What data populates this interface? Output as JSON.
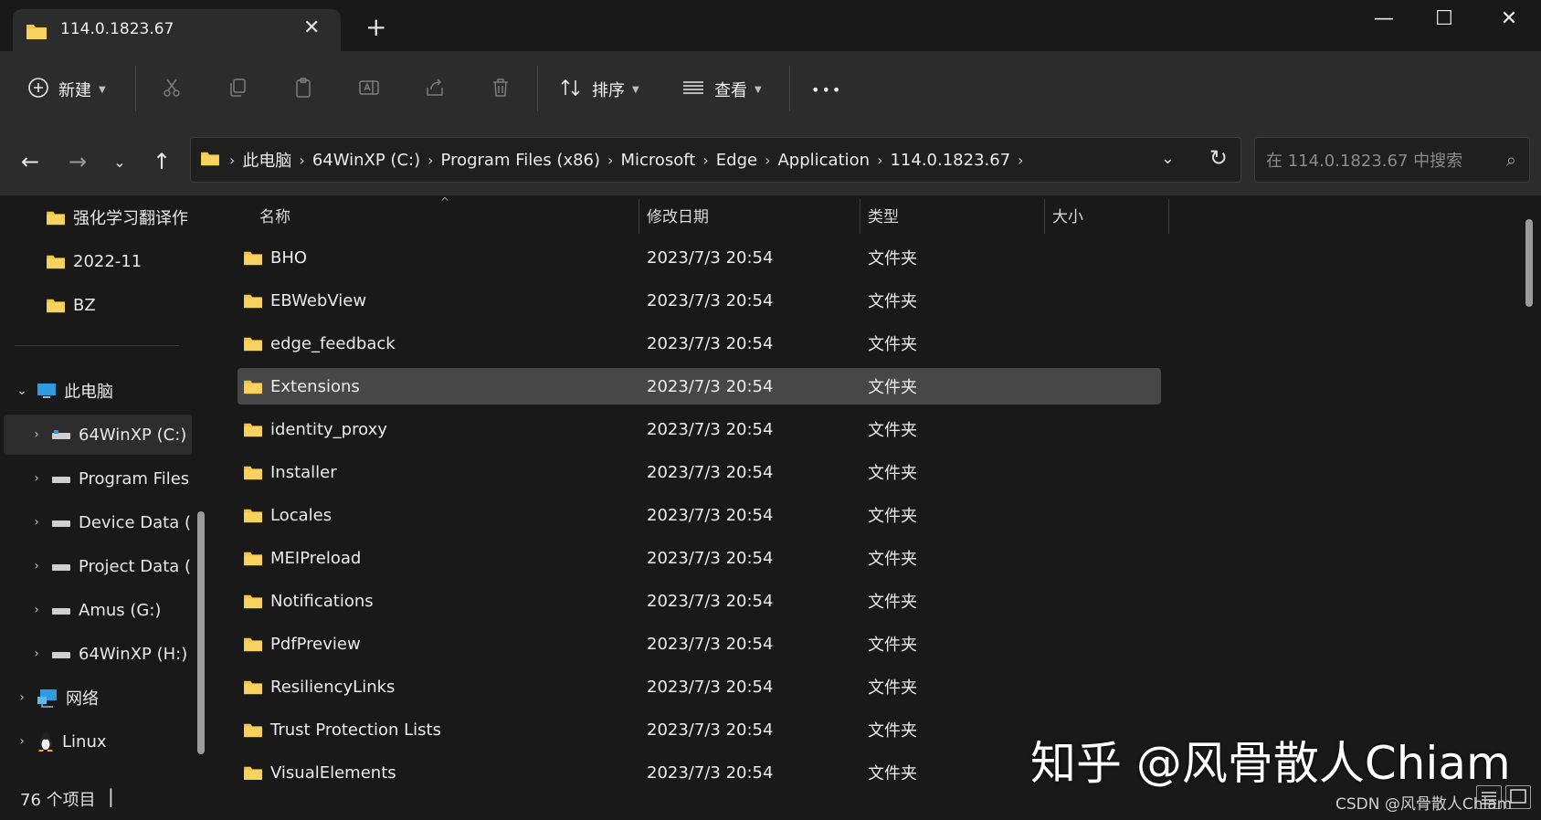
{
  "window": {
    "tab_title": "114.0.1823.67",
    "new_tab_label": "+",
    "controls": {
      "minimize": "—",
      "maximize": "☐",
      "close": "✕"
    }
  },
  "toolbar": {
    "new_label": "新建",
    "sort_label": "排序",
    "view_label": "查看",
    "more_label": "•••"
  },
  "address": {
    "crumbs": [
      "此电脑",
      "64WinXP  (C:)",
      "Program Files (x86)",
      "Microsoft",
      "Edge",
      "Application",
      "114.0.1823.67"
    ],
    "search_placeholder": "在 114.0.1823.67 中搜索"
  },
  "sidebar": {
    "items": [
      {
        "label": "强化学习翻译作",
        "icon": "folder-icon"
      },
      {
        "label": "2022-11",
        "icon": "folder-icon"
      },
      {
        "label": "BZ",
        "icon": "folder-icon"
      },
      {
        "label": "此电脑",
        "icon": "computer-icon"
      },
      {
        "label": "64WinXP  (C:)",
        "icon": "drive-icon"
      },
      {
        "label": "Program Files",
        "icon": "drive-icon"
      },
      {
        "label": "Device Data (",
        "icon": "drive-icon"
      },
      {
        "label": "Project Data (",
        "icon": "drive-icon"
      },
      {
        "label": "Amus (G:)",
        "icon": "drive-icon"
      },
      {
        "label": "64WinXP  (H:)",
        "icon": "drive-icon"
      },
      {
        "label": "网络",
        "icon": "network-icon"
      },
      {
        "label": "Linux",
        "icon": "linux-icon"
      }
    ]
  },
  "columns": {
    "name": "名称",
    "modified": "修改日期",
    "type": "类型",
    "size": "大小"
  },
  "files": [
    {
      "name": "BHO",
      "modified": "2023/7/3 20:54",
      "type": "文件夹"
    },
    {
      "name": "EBWebView",
      "modified": "2023/7/3 20:54",
      "type": "文件夹"
    },
    {
      "name": "edge_feedback",
      "modified": "2023/7/3 20:54",
      "type": "文件夹"
    },
    {
      "name": "Extensions",
      "modified": "2023/7/3 20:54",
      "type": "文件夹"
    },
    {
      "name": "identity_proxy",
      "modified": "2023/7/3 20:54",
      "type": "文件夹"
    },
    {
      "name": "Installer",
      "modified": "2023/7/3 20:54",
      "type": "文件夹"
    },
    {
      "name": "Locales",
      "modified": "2023/7/3 20:54",
      "type": "文件夹"
    },
    {
      "name": "MEIPreload",
      "modified": "2023/7/3 20:54",
      "type": "文件夹"
    },
    {
      "name": "Notifications",
      "modified": "2023/7/3 20:54",
      "type": "文件夹"
    },
    {
      "name": "PdfPreview",
      "modified": "2023/7/3 20:54",
      "type": "文件夹"
    },
    {
      "name": "ResiliencyLinks",
      "modified": "2023/7/3 20:54",
      "type": "文件夹"
    },
    {
      "name": "Trust Protection Lists",
      "modified": "2023/7/3 20:54",
      "type": "文件夹"
    },
    {
      "name": "VisualElements",
      "modified": "2023/7/3 20:54",
      "type": "文件夹"
    }
  ],
  "status": {
    "count": "76 个项目",
    "cursor": "|"
  },
  "watermark": {
    "zhihu": "知乎 @风骨散人Chiam",
    "csdn": "CSDN @风骨散人Chiam"
  },
  "colors": {
    "folder": "#f4c542",
    "selection": "#474747",
    "background": "#191919",
    "toolbar": "#2c2c2c"
  }
}
